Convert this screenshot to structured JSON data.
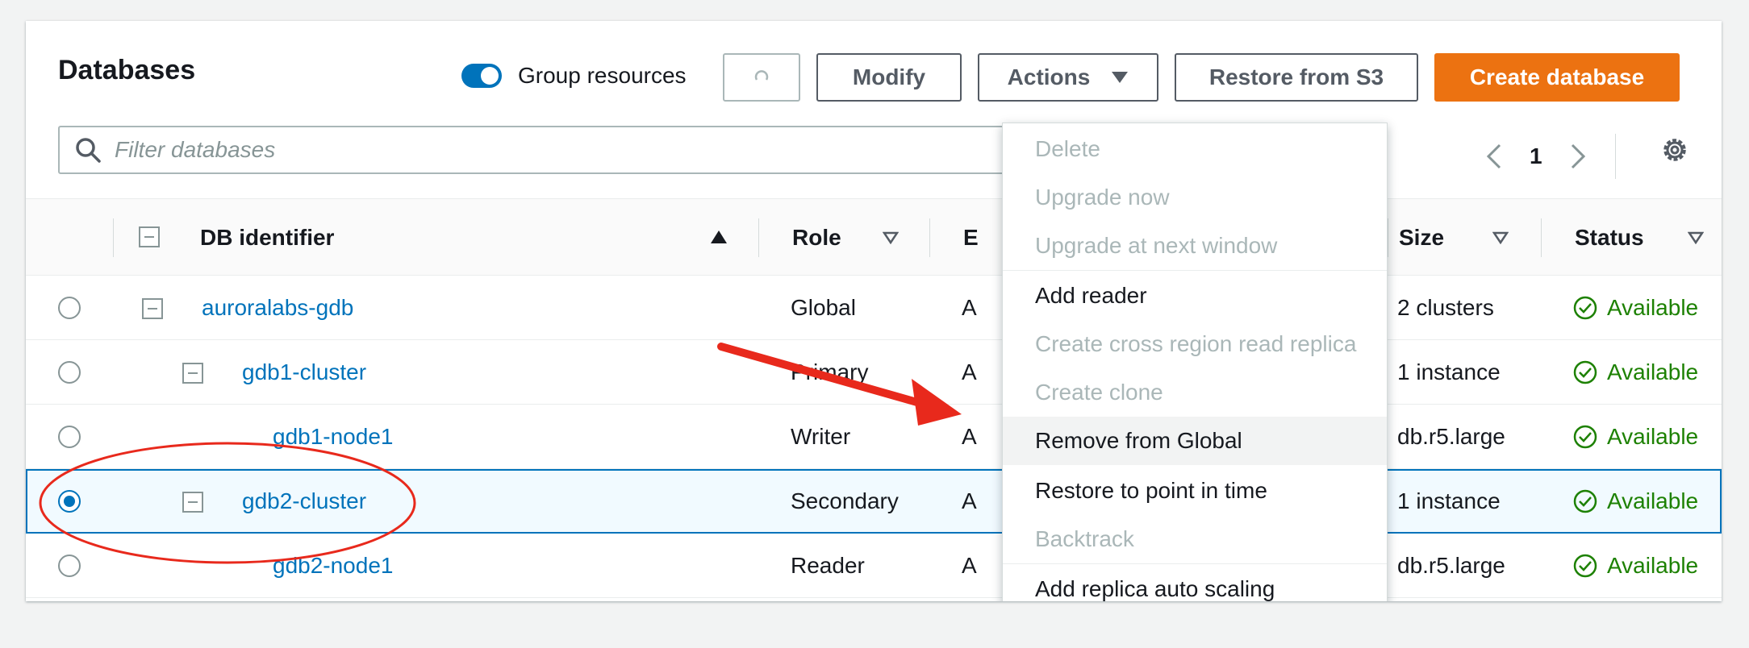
{
  "header": {
    "title": "Databases",
    "group_resources_label": "Group resources",
    "group_resources_on": true
  },
  "toolbar": {
    "modify_label": "Modify",
    "actions_label": "Actions",
    "restore_label": "Restore from S3",
    "create_label": "Create database"
  },
  "search": {
    "placeholder": "Filter databases"
  },
  "pagination": {
    "page": "1"
  },
  "table": {
    "columns": {
      "db_identifier": "DB identifier",
      "role": "Role",
      "engine": "E",
      "size": "Size",
      "status": "Status"
    },
    "rows": [
      {
        "id": "auroralabs-gdb",
        "role": "Global",
        "engine": "A",
        "size": "2 clusters",
        "status": "Available",
        "selected": false
      },
      {
        "id": "gdb1-cluster",
        "role": "Primary",
        "engine": "A",
        "size": "1 instance",
        "status": "Available",
        "selected": false
      },
      {
        "id": "gdb1-node1",
        "role": "Writer",
        "engine": "A",
        "size": "db.r5.large",
        "status": "Available",
        "selected": false
      },
      {
        "id": "gdb2-cluster",
        "role": "Secondary",
        "engine": "A",
        "size": "1 instance",
        "status": "Available",
        "selected": true
      },
      {
        "id": "gdb2-node1",
        "role": "Reader",
        "engine": "A",
        "size": "db.r5.large",
        "status": "Available",
        "selected": false
      }
    ]
  },
  "actions_menu": {
    "items": [
      {
        "label": "Delete",
        "disabled": true
      },
      {
        "label": "Upgrade now",
        "disabled": true
      },
      {
        "label": "Upgrade at next window",
        "disabled": true
      },
      {
        "label": "Add reader",
        "disabled": false
      },
      {
        "label": "Create cross region read replica",
        "disabled": true
      },
      {
        "label": "Create clone",
        "disabled": true
      },
      {
        "label": "Remove from Global",
        "disabled": false,
        "highlighted": true
      },
      {
        "label": "Restore to point in time",
        "disabled": false
      },
      {
        "label": "Backtrack",
        "disabled": true
      },
      {
        "label": "Add replica auto scaling",
        "disabled": false
      }
    ]
  },
  "colors": {
    "accent": "#0073bb",
    "primary_button": "#ec7211",
    "status_available": "#1d8102",
    "annotation": "#e8291c"
  },
  "icons": [
    "search-icon",
    "refresh-icon",
    "caret-down-icon",
    "chevron-left-icon",
    "chevron-right-icon",
    "gear-icon",
    "check-circle-icon",
    "sort-ascending-icon",
    "sort-icon",
    "collapse-icon"
  ]
}
